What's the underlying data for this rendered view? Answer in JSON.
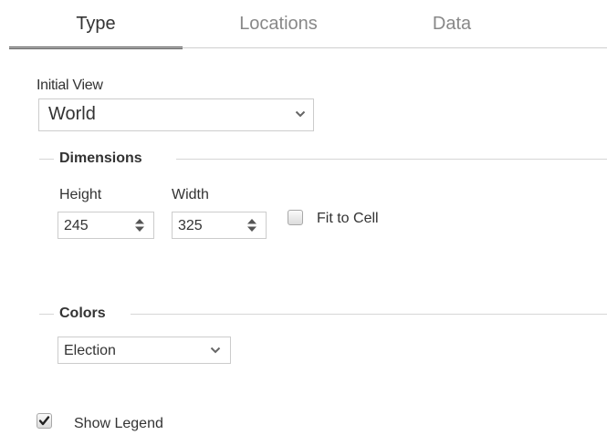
{
  "tabs": [
    {
      "label": "Type",
      "active": true
    },
    {
      "label": "Locations",
      "active": false
    },
    {
      "label": "Data",
      "active": false
    }
  ],
  "initial_view": {
    "label": "Initial View",
    "value": "World"
  },
  "dimensions": {
    "title": "Dimensions",
    "height_label": "Height",
    "height_value": "245",
    "width_label": "Width",
    "width_value": "325",
    "fit_to_cell_label": "Fit to Cell",
    "fit_to_cell_checked": false
  },
  "colors": {
    "title": "Colors",
    "value": "Election"
  },
  "show_legend": {
    "label": "Show Legend",
    "checked": true
  },
  "icons": {
    "dropdown": "chevron-down-icon",
    "spinner": "spinner-arrows-icon",
    "check": "checkmark-icon"
  }
}
